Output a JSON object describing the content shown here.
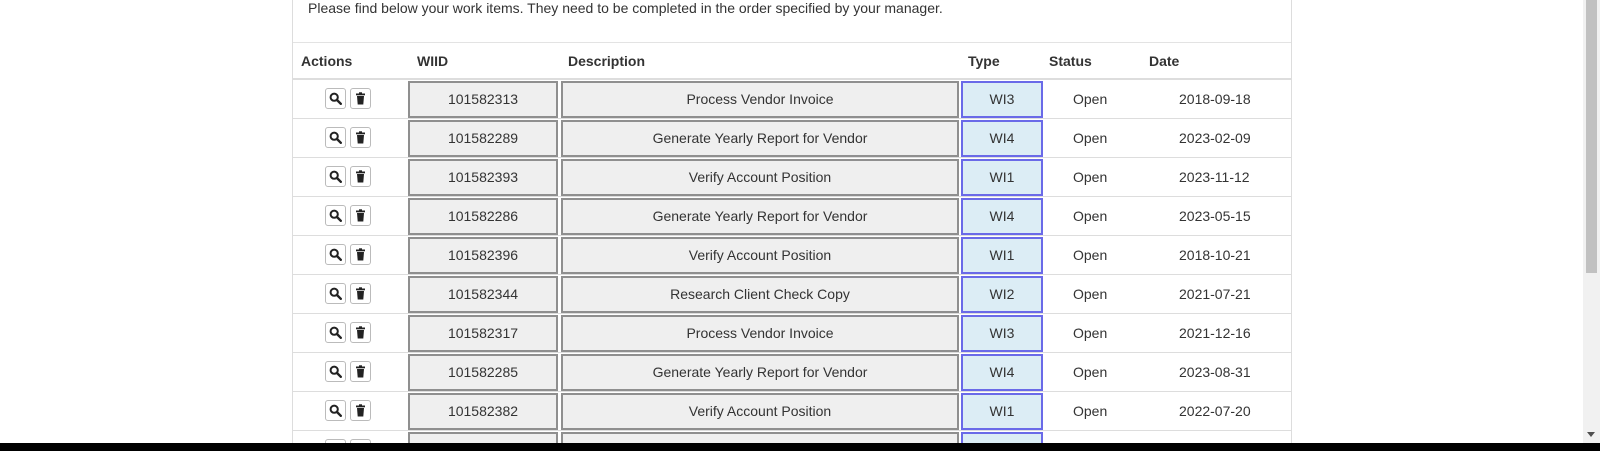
{
  "intro_text": "Please find below your work items. They need to be completed in the order specified by your manager.",
  "columns": {
    "actions": "Actions",
    "wiid": "WIID",
    "description": "Description",
    "type": "Type",
    "status": "Status",
    "date": "Date"
  },
  "icons": {
    "view": "search-icon",
    "delete": "trash-icon"
  },
  "rows": [
    {
      "wiid": "101582313",
      "description": "Process Vendor Invoice",
      "type": "WI3",
      "status": "Open",
      "date": "2018-09-18"
    },
    {
      "wiid": "101582289",
      "description": "Generate Yearly Report for Vendor",
      "type": "WI4",
      "status": "Open",
      "date": "2023-02-09"
    },
    {
      "wiid": "101582393",
      "description": "Verify Account Position",
      "type": "WI1",
      "status": "Open",
      "date": "2023-11-12"
    },
    {
      "wiid": "101582286",
      "description": "Generate Yearly Report for Vendor",
      "type": "WI4",
      "status": "Open",
      "date": "2023-05-15"
    },
    {
      "wiid": "101582396",
      "description": "Verify Account Position",
      "type": "WI1",
      "status": "Open",
      "date": "2018-10-21"
    },
    {
      "wiid": "101582344",
      "description": "Research Client Check Copy",
      "type": "WI2",
      "status": "Open",
      "date": "2021-07-21"
    },
    {
      "wiid": "101582317",
      "description": "Process Vendor Invoice",
      "type": "WI3",
      "status": "Open",
      "date": "2021-12-16"
    },
    {
      "wiid": "101582285",
      "description": "Generate Yearly Report for Vendor",
      "type": "WI4",
      "status": "Open",
      "date": "2023-08-31"
    },
    {
      "wiid": "101582382",
      "description": "Verify Account Position",
      "type": "WI1",
      "status": "Open",
      "date": "2022-07-20"
    },
    {
      "wiid": "",
      "description": "",
      "type": "",
      "status": "",
      "date": ""
    }
  ]
}
